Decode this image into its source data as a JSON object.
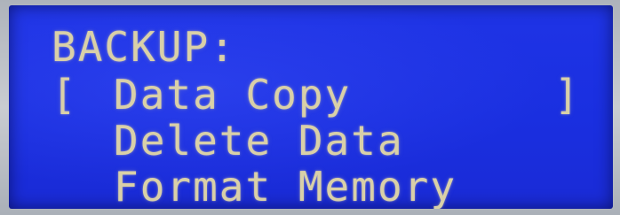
{
  "screen": {
    "title": "BACKUP:",
    "selection_open": "[",
    "selection_close": "]",
    "menu_items": [
      {
        "label": "Data Copy",
        "selected": true
      },
      {
        "label": "Delete Data",
        "selected": false
      },
      {
        "label": "Format Memory",
        "selected": false
      }
    ]
  },
  "colors": {
    "background": "#1f34e6",
    "text": "#d9d0a8"
  }
}
